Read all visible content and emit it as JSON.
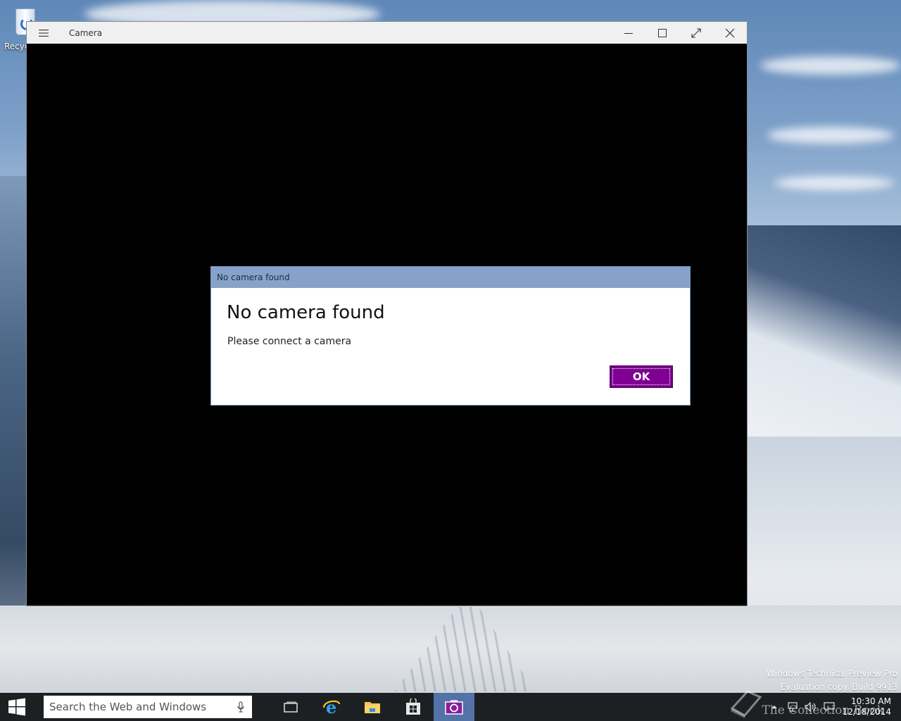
{
  "desktop": {
    "recycle_bin_label": "Recyc",
    "watermark_line1": "Windows Technical Preview Pro",
    "watermark_line2": "Evaluation copy. Build 9913"
  },
  "window": {
    "title": "Camera",
    "menu_icon": "hamburger-icon",
    "caption_buttons": [
      "minimize-icon",
      "maximize-icon",
      "fullscreen-icon",
      "close-icon"
    ]
  },
  "dialog": {
    "titlebar": "No camera found",
    "heading": "No camera found",
    "message": "Please connect a camera",
    "ok_label": "OK",
    "accent_color": "#800093"
  },
  "taskbar": {
    "search_placeholder": "Search the Web and Windows",
    "apps": [
      "task-view-icon",
      "internet-explorer-icon",
      "file-explorer-icon",
      "store-icon",
      "camera-icon"
    ],
    "active_app": "camera-icon",
    "clock_time": "10:30 AM",
    "clock_date": "12/18/2014",
    "overlay_watermark": "The Collection Book"
  }
}
